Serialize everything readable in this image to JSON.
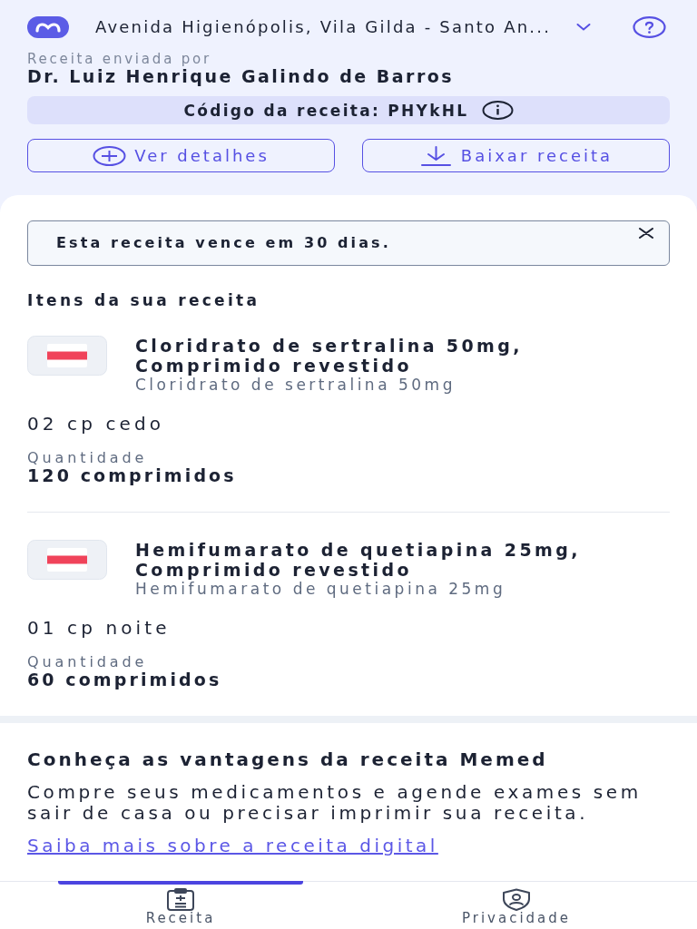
{
  "header": {
    "address": "Avenida Higienópolis, Vila Gilda - Santo An...",
    "sender_label": "Receita enviada por",
    "doctor": "Dr. Luiz Henrique Galindo de Barros",
    "code": "Código da receita: PHYkHL"
  },
  "actions": [
    {
      "kind": "details",
      "label": "Ver detalhes"
    },
    {
      "kind": "download",
      "label": "Baixar receita"
    }
  ],
  "alert": {
    "text": "Esta receita vence em 30 dias."
  },
  "items_title": "Itens da sua receita",
  "items": [
    {
      "name": "Cloridrato de sertralina 50mg, Comprimido revestido",
      "generic": "Cloridrato de sertralina 50mg",
      "dosage": "02 cp cedo",
      "quantity_label": "Quantidade",
      "quantity": "120 comprimidos"
    },
    {
      "name": "Hemifumarato de quetiapina 25mg, Comprimido revestido",
      "generic": "Hemifumarato de quetiapina 25mg",
      "dosage": "01 cp noite",
      "quantity_label": "Quantidade",
      "quantity": "60 comprimidos"
    }
  ],
  "promo": {
    "title": "Conheça as vantagens da receita Memed",
    "text": "Compre seus medicamentos e agende exames sem sair de casa ou precisar imprimir sua receita.",
    "link": "Saiba mais sobre a receita digital"
  },
  "nav": [
    {
      "kind": "prescription",
      "label": "Receita",
      "selected": true
    },
    {
      "kind": "privacy",
      "label": "Privacidade",
      "selected": false
    }
  ]
}
